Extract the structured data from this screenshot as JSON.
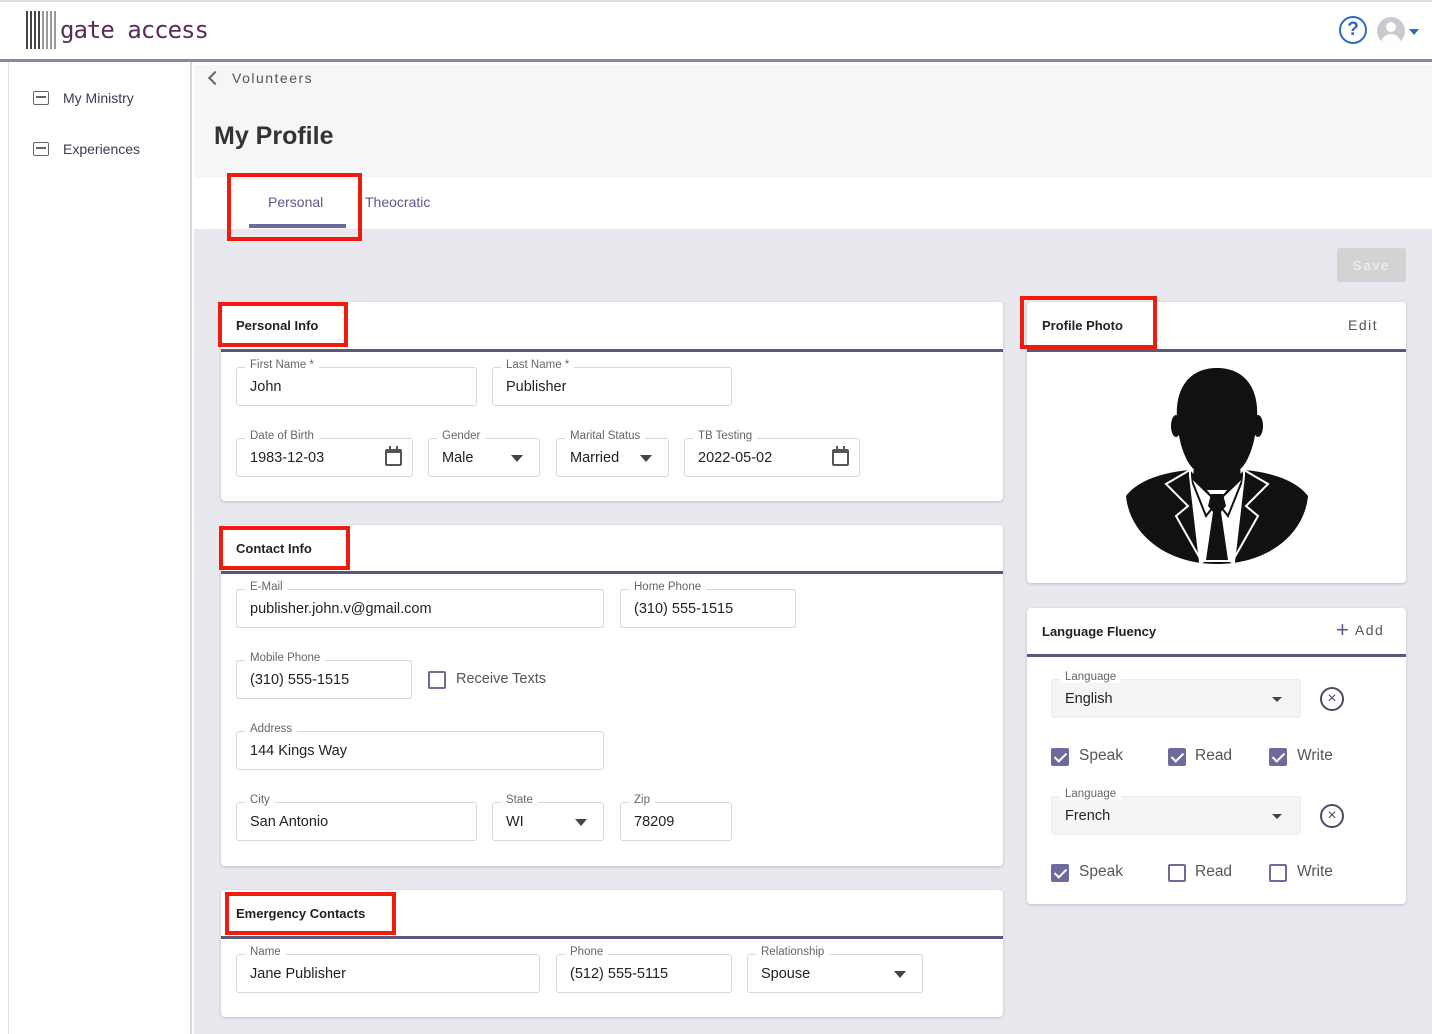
{
  "app": {
    "logo_text": "gate access"
  },
  "sidebar": {
    "items": [
      {
        "label": "My Ministry",
        "icon": "briefcase-icon"
      },
      {
        "label": "Experiences",
        "icon": "newspaper-icon"
      }
    ]
  },
  "breadcrumb": {
    "label": "Volunteers"
  },
  "page": {
    "title": "My Profile"
  },
  "tabs": [
    {
      "label": "Personal",
      "active": true
    },
    {
      "label": "Theocratic",
      "active": false
    }
  ],
  "toolbar": {
    "save_label": "Save"
  },
  "personal_info": {
    "title": "Personal Info",
    "first_name": {
      "label": "First Name *",
      "value": "John"
    },
    "last_name": {
      "label": "Last Name *",
      "value": "Publisher"
    },
    "dob": {
      "label": "Date of Birth",
      "value": "1983-12-03"
    },
    "gender": {
      "label": "Gender",
      "value": "Male"
    },
    "marital": {
      "label": "Marital Status",
      "value": "Married"
    },
    "tb": {
      "label": "TB Testing",
      "value": "2022-05-02"
    }
  },
  "contact_info": {
    "title": "Contact Info",
    "email": {
      "label": "E-Mail",
      "value": "publisher.john.v@gmail.com"
    },
    "home_phone": {
      "label": "Home Phone",
      "value": "(310) 555-1515"
    },
    "mobile_phone": {
      "label": "Mobile Phone",
      "value": "(310) 555-1515"
    },
    "receive_texts": {
      "label": "Receive Texts",
      "checked": false
    },
    "address": {
      "label": "Address",
      "value": "144 Kings Way"
    },
    "city": {
      "label": "City",
      "value": "San Antonio"
    },
    "state": {
      "label": "State",
      "value": "WI"
    },
    "zip": {
      "label": "Zip",
      "value": "78209"
    }
  },
  "emergency": {
    "title": "Emergency Contacts",
    "name": {
      "label": "Name",
      "value": "Jane Publisher"
    },
    "phone": {
      "label": "Phone",
      "value": "(512) 555-5115"
    },
    "relationship": {
      "label": "Relationship",
      "value": "Spouse"
    }
  },
  "profile_photo": {
    "title": "Profile Photo",
    "edit_label": "Edit"
  },
  "language_fluency": {
    "title": "Language Fluency",
    "add_label": "Add",
    "entries": [
      {
        "label": "Language",
        "value": "English",
        "speak": true,
        "read": true,
        "write": true
      },
      {
        "label": "Language",
        "value": "French",
        "speak": true,
        "read": false,
        "write": false
      }
    ],
    "speak_label": "Speak",
    "read_label": "Read",
    "write_label": "Write"
  },
  "colors": {
    "accent": "#6e6b9c",
    "highlight": "#ee1c0c",
    "logo": "#5b2c5a"
  }
}
